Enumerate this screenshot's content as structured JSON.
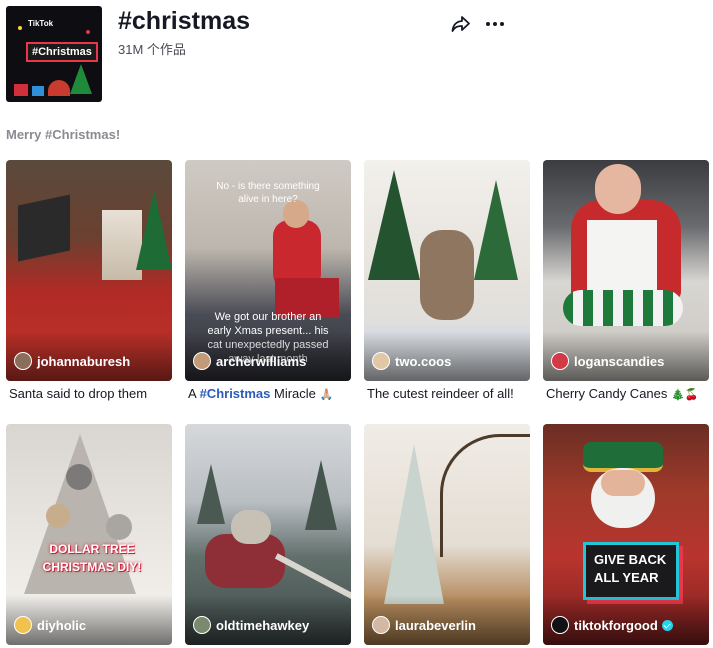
{
  "header": {
    "cover_brand": "TikTok",
    "cover_tag": "#Christmas",
    "title": "#christmas",
    "count": "31M 个作品",
    "description": "Merry #Christmas!"
  },
  "videos": [
    {
      "author": "johannaburesh",
      "caption": "Santa said to drop them"
    },
    {
      "author": "archerwilliams",
      "caption_prefix": "A ",
      "caption_tag": "#Christmas",
      "caption_suffix": " Miracle",
      "caption_emoji": "🙏🏼",
      "overlay_top": "No - is there something alive in here?",
      "overlay_bottom": "We got our brother an early Xmas present... his cat unexpectedly passed away last month"
    },
    {
      "author": "two.coos",
      "caption": "The cutest reindeer of all!"
    },
    {
      "author": "loganscandies",
      "caption": "Cherry Candy Canes",
      "caption_emoji": "🎄🍒"
    },
    {
      "author": "diyholic",
      "overlay": "DOLLAR TREE CHRISTMAS DIY!"
    },
    {
      "author": "oldtimehawkey"
    },
    {
      "author": "laurabeverlin"
    },
    {
      "author": "tiktokforgood",
      "overlay": "GIVE BACK ALL YEAR"
    }
  ],
  "icons": {
    "share": "share-icon",
    "more": "more-icon"
  }
}
